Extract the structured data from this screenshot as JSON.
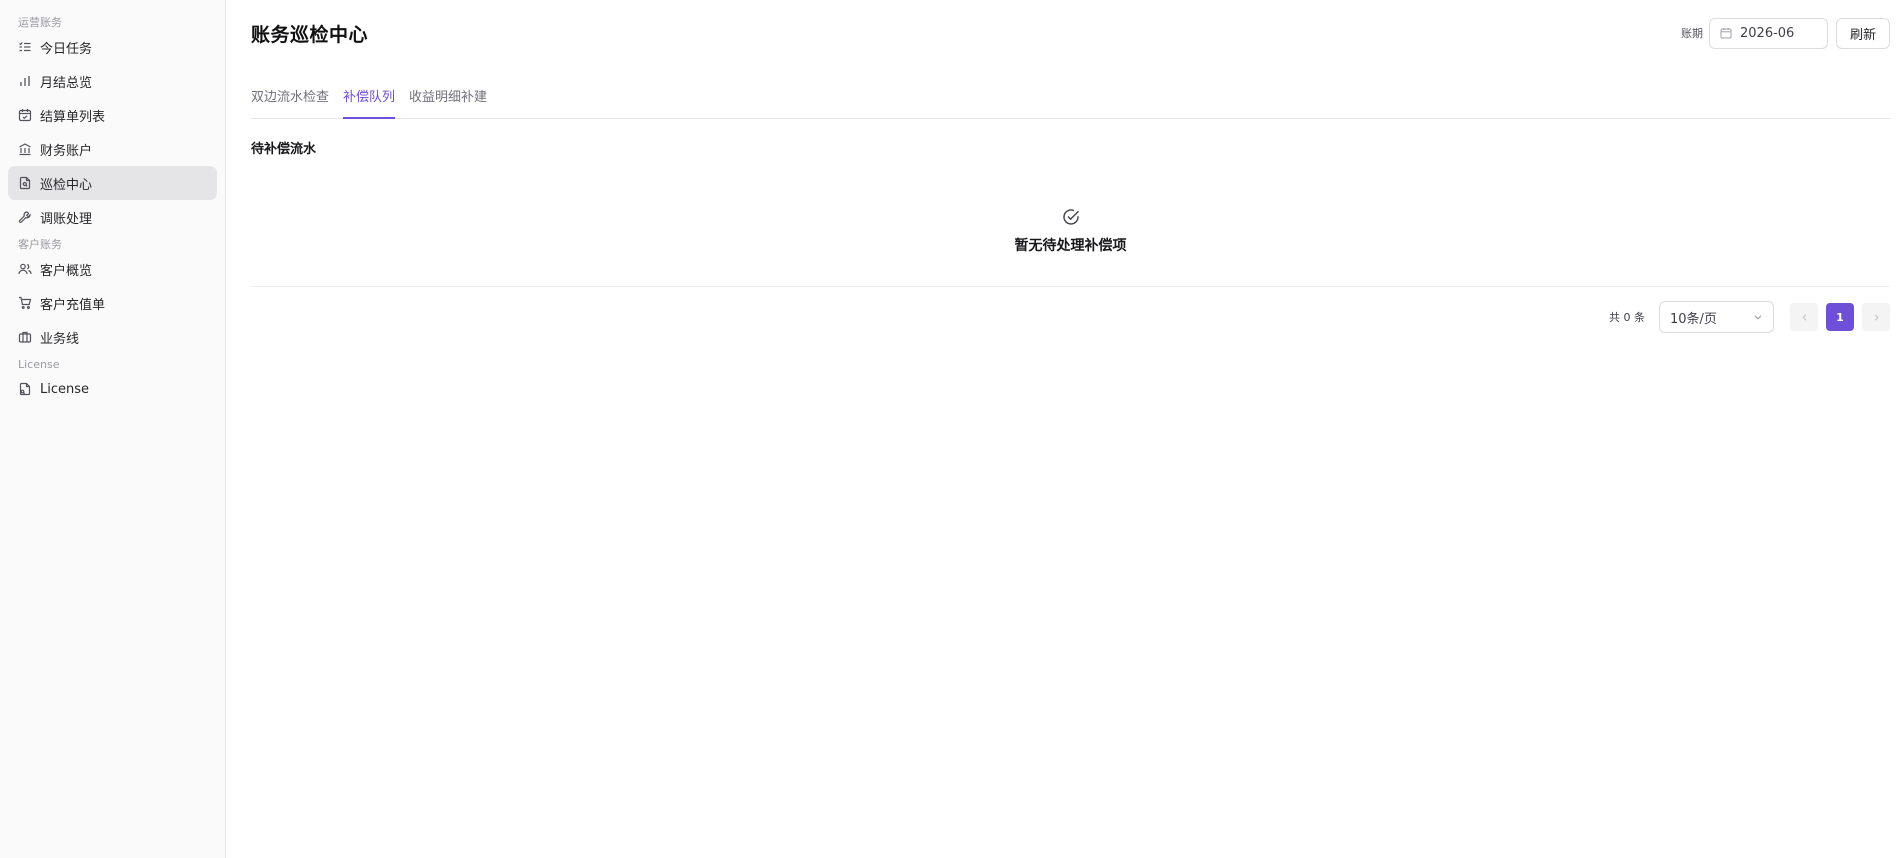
{
  "sidebar": {
    "groups": [
      {
        "label": "运营账务",
        "items": [
          {
            "label": "今日任务",
            "icon": "list-check-icon"
          },
          {
            "label": "月结总览",
            "icon": "bar-chart-icon"
          },
          {
            "label": "结算单列表",
            "icon": "calendar-check-icon"
          },
          {
            "label": "财务账户",
            "icon": "bank-icon"
          },
          {
            "label": "巡检中心",
            "icon": "file-search-icon"
          },
          {
            "label": "调账处理",
            "icon": "wrench-icon"
          }
        ]
      },
      {
        "label": "客户账务",
        "items": [
          {
            "label": "客户概览",
            "icon": "users-icon"
          },
          {
            "label": "客户充值单",
            "icon": "cart-icon"
          },
          {
            "label": "业务线",
            "icon": "briefcase-icon"
          }
        ]
      },
      {
        "label": "License",
        "items": [
          {
            "label": "License",
            "icon": "license-icon"
          }
        ]
      }
    ],
    "active_item": "巡检中心"
  },
  "header": {
    "title": "账务巡检中心",
    "period_label": "账期",
    "period_value": "2026-06",
    "refresh_label": "刷新"
  },
  "tabs": [
    {
      "label": "双边流水检查"
    },
    {
      "label": "补偿队列"
    },
    {
      "label": "收益明细补建"
    }
  ],
  "active_tab": "补偿队列",
  "section": {
    "title": "待补偿流水",
    "empty_text": "暂无待处理补偿项"
  },
  "pagination": {
    "total_text": "共 0 条",
    "page_size": "10条/页",
    "current_page": "1"
  },
  "colors": {
    "accent": "#6d4fd8",
    "sidebar_bg": "#fafafa",
    "active_item_bg": "#e5e5e8"
  }
}
